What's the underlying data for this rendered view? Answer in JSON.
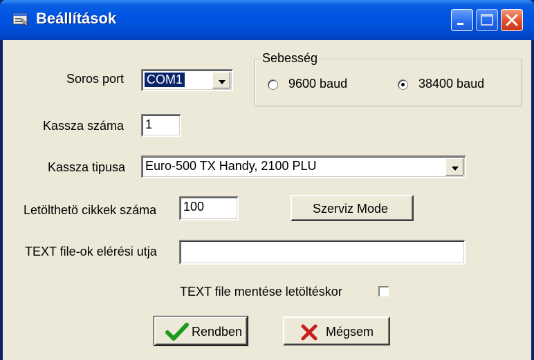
{
  "window": {
    "title": "Beállítások",
    "app_icon": "settings-window-icon"
  },
  "serial_port": {
    "label": "Soros port",
    "value": "COM1"
  },
  "speed": {
    "group_title": "Sebesség",
    "options": [
      {
        "label": "9600 baud",
        "selected": false
      },
      {
        "label": "38400 baud",
        "selected": true
      }
    ]
  },
  "register_number": {
    "label": "Kassza száma",
    "value": "1"
  },
  "register_type": {
    "label": "Kassza tipusa",
    "value": "Euro-500 TX Handy, 2100 PLU"
  },
  "downloadable_items": {
    "label": "Letölthetö cikkek száma",
    "value": "100"
  },
  "service_mode_button": "Szerviz Mode",
  "text_path": {
    "label": "TEXT file-ok elérési utja",
    "value": ""
  },
  "save_text": {
    "label": "TEXT file mentése letöltéskor",
    "checked": false
  },
  "buttons": {
    "ok": "Rendben",
    "cancel": "Mégsem"
  },
  "colors": {
    "titlebar": "#0054e3",
    "close_button": "#e0502a",
    "client_bg": "#ece9d8",
    "ok_check": "#1e9a1e",
    "cancel_x": "#c81e1e"
  }
}
